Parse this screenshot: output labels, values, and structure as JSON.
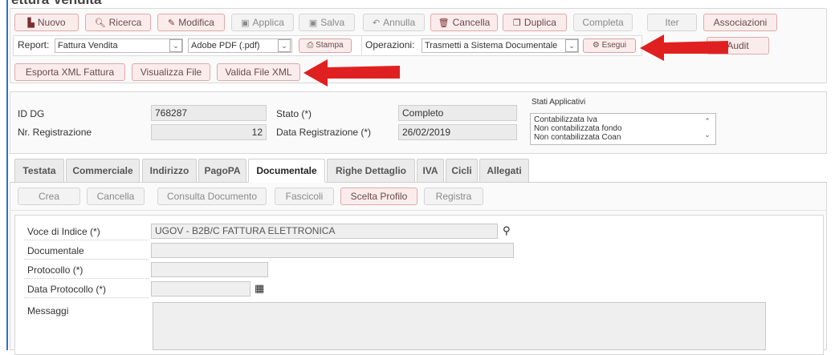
{
  "page": {
    "title_crop": "ettura Vendita"
  },
  "toolbar": {
    "buttons": [
      {
        "label": "Nuovo",
        "icon": "document-icon"
      },
      {
        "label": "Ricerca",
        "icon": "search-icon"
      },
      {
        "label": "Modifica",
        "icon": "pencil-icon"
      },
      {
        "label": "Applica",
        "icon": "save-icon"
      },
      {
        "label": "Salva",
        "icon": "save-icon"
      },
      {
        "label": "Annulla",
        "icon": "undo-icon"
      },
      {
        "label": "Cancella",
        "icon": "trash-icon"
      },
      {
        "label": "Duplica",
        "icon": "copy-icon"
      },
      {
        "label": "Completa"
      },
      {
        "label": "Iter"
      },
      {
        "label": "Associazioni"
      }
    ],
    "report_label": "Report:",
    "report_value": "Fattura Vendita",
    "format_value": "Adobe PDF (.pdf)",
    "stampa_label": "Stampa",
    "operazioni_label": "Operazioni:",
    "operazioni_value": "Trasmetti a Sistema Documentale",
    "esegui_label": "Esegui",
    "audit_label": "Audit",
    "xml_buttons": [
      "Esporta XML Fattura",
      "Visualizza File",
      "Valida File XML"
    ]
  },
  "info": {
    "id_dg_label": "ID DG",
    "id_dg_value": "768287",
    "nr_reg_label": "Nr. Registrazione",
    "nr_reg_value": "12",
    "stato_label": "Stato (*)",
    "stato_value": "Completo",
    "data_reg_label": "Data Registrazione (*)",
    "data_reg_value": "26/02/2019",
    "stati_label": "Stati Applicativi",
    "stati_items": [
      "Contabilizzata Iva",
      "Non contabilizzata fondo",
      "Non contabilizzata Coan"
    ]
  },
  "tabs": [
    "Testata",
    "Commerciale",
    "Indirizzo",
    "PagoPA",
    "Documentale",
    "Righe Dettaglio",
    "IVA",
    "Cicli",
    "Allegati"
  ],
  "active_tab": "Documentale",
  "doc_toolbar": [
    "Crea",
    "Cancella",
    "Consulta Documento",
    "Fascicoli",
    "Scelta Profilo",
    "Registra"
  ],
  "form": {
    "voce_label": "Voce di Indice (*)",
    "voce_value": "UGOV - B2B/C FATTURA ELETTRONICA",
    "documentale_label": "Documentale",
    "protocollo_label": "Protocollo (*)",
    "data_protocollo_label": "Data Protocollo (*)",
    "messaggi_label": "Messaggi"
  },
  "colors": {
    "accent_red": "#e02020",
    "button_pink": "#fbecec",
    "left_edge": "#2f6fd0"
  }
}
